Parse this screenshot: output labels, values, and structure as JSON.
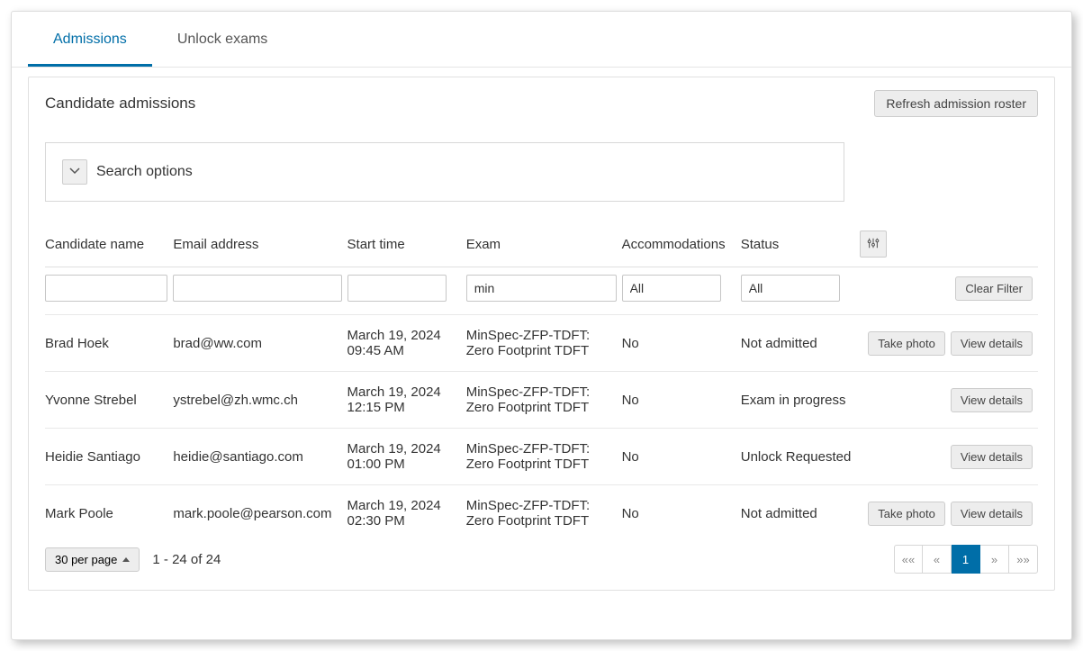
{
  "tabs": {
    "admissions": "Admissions",
    "unlock": "Unlock exams"
  },
  "card": {
    "title": "Candidate admissions",
    "refresh_btn": "Refresh admission roster",
    "search_options": "Search options"
  },
  "columns": {
    "name": "Candidate name",
    "email": "Email address",
    "start": "Start time",
    "exam": "Exam",
    "acc": "Accommodations",
    "status": "Status"
  },
  "filters": {
    "name": "",
    "email": "",
    "start": "",
    "exam": "min",
    "acc": "All",
    "status": "All",
    "clear_btn": "Clear Filter"
  },
  "actions": {
    "take_photo": "Take photo",
    "view_details": "View details"
  },
  "rows": [
    {
      "name": "Brad Hoek",
      "email": "brad@ww.com",
      "start": "March 19, 2024 09:45 AM",
      "exam": "MinSpec-ZFP-TDFT: Zero Footprint TDFT",
      "acc": "No",
      "status": "Not admitted",
      "take_photo": true
    },
    {
      "name": "Yvonne Strebel",
      "email": "ystrebel@zh.wmc.ch",
      "start": "March 19, 2024 12:15 PM",
      "exam": "MinSpec-ZFP-TDFT: Zero Footprint TDFT",
      "acc": "No",
      "status": "Exam in progress",
      "take_photo": false
    },
    {
      "name": "Heidie Santiago",
      "email": "heidie@santiago.com",
      "start": "March 19, 2024 01:00 PM",
      "exam": "MinSpec-ZFP-TDFT: Zero Footprint TDFT",
      "acc": "No",
      "status": "Unlock Requested",
      "take_photo": false
    },
    {
      "name": "Mark Poole",
      "email": "mark.poole@pearson.com",
      "start": "March 19, 2024 02:30 PM",
      "exam": "MinSpec-ZFP-TDFT: Zero Footprint TDFT",
      "acc": "No",
      "status": "Not admitted",
      "take_photo": true
    }
  ],
  "footer": {
    "per_page": "30 per page",
    "range": "1 - 24 of 24",
    "pages": {
      "first": "««",
      "prev": "«",
      "current": "1",
      "next": "»",
      "last": "»»"
    }
  }
}
